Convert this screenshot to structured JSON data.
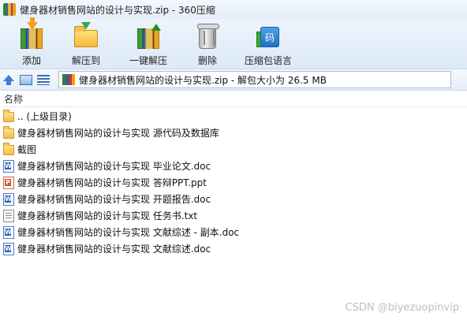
{
  "window": {
    "title": "健身器材销售网站的设计与实现.zip - 360压缩",
    "app_icon": "archive-icon"
  },
  "toolbar": {
    "items": [
      {
        "id": "add",
        "label": "添加",
        "icon": "add-to-archive-icon"
      },
      {
        "id": "extract",
        "label": "解压到",
        "icon": "extract-to-folder-icon"
      },
      {
        "id": "oneclick",
        "label": "一键解压",
        "icon": "one-click-extract-icon"
      },
      {
        "id": "delete",
        "label": "删除",
        "icon": "trash-icon"
      },
      {
        "id": "lang",
        "label": "压缩包语言",
        "icon": "language-icon",
        "glyph": "码"
      }
    ]
  },
  "addressbar": {
    "path": "健身器材销售网站的设计与实现.zip - 解包大小为 26.5 MB"
  },
  "filelist": {
    "column_name": "名称",
    "rows": [
      {
        "name": ".. (上级目录)",
        "type": "folder"
      },
      {
        "name": "健身器材销售网站的设计与实现 源代码及数据库",
        "type": "folder"
      },
      {
        "name": "截图",
        "type": "folder"
      },
      {
        "name": "健身器材销售网站的设计与实现 毕业论文.doc",
        "type": "doc"
      },
      {
        "name": "健身器材销售网站的设计与实现 答辩PPT.ppt",
        "type": "ppt"
      },
      {
        "name": "健身器材销售网站的设计与实现 开题报告.doc",
        "type": "doc"
      },
      {
        "name": "健身器材销售网站的设计与实现 任务书.txt",
        "type": "txt"
      },
      {
        "name": "健身器材销售网站的设计与实现 文献综述 - 副本.doc",
        "type": "doc"
      },
      {
        "name": "健身器材销售网站的设计与实现 文献综述.doc",
        "type": "doc"
      }
    ]
  },
  "watermark": "CSDN @biyezuopinvip"
}
